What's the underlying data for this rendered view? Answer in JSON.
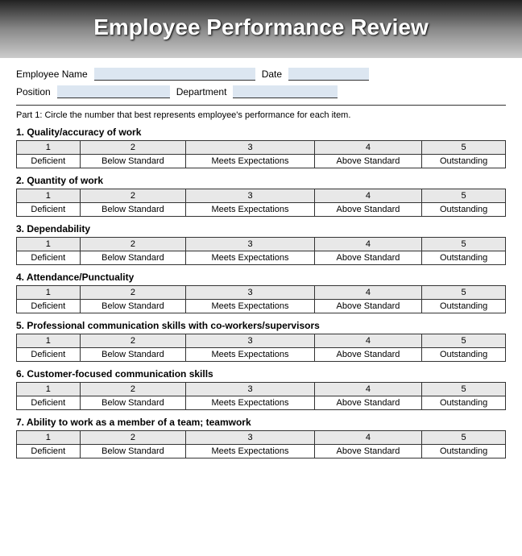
{
  "header": {
    "title": "Employee Performance Review"
  },
  "form": {
    "employee_name_label": "Employee Name",
    "date_label": "Date",
    "position_label": "Position",
    "department_label": "Department",
    "instructions": "Part 1: Circle the number that best represents employee's performance for each item."
  },
  "ratings": {
    "columns": [
      "1",
      "2",
      "3",
      "4",
      "5"
    ],
    "labels": [
      "Deficient",
      "Below Standard",
      "Meets Expectations",
      "Above Standard",
      "Outstanding"
    ]
  },
  "sections": [
    {
      "id": "1",
      "title": "1. Quality/accuracy of work"
    },
    {
      "id": "2",
      "title": "2. Quantity of work"
    },
    {
      "id": "3",
      "title": "3. Dependability"
    },
    {
      "id": "4",
      "title": "4. Attendance/Punctuality"
    },
    {
      "id": "5",
      "title": "5. Professional communication skills with co-workers/supervisors"
    },
    {
      "id": "6",
      "title": "6. Customer-focused communication skills"
    },
    {
      "id": "7",
      "title": "7. Ability to work as a member of a team; teamwork"
    }
  ]
}
